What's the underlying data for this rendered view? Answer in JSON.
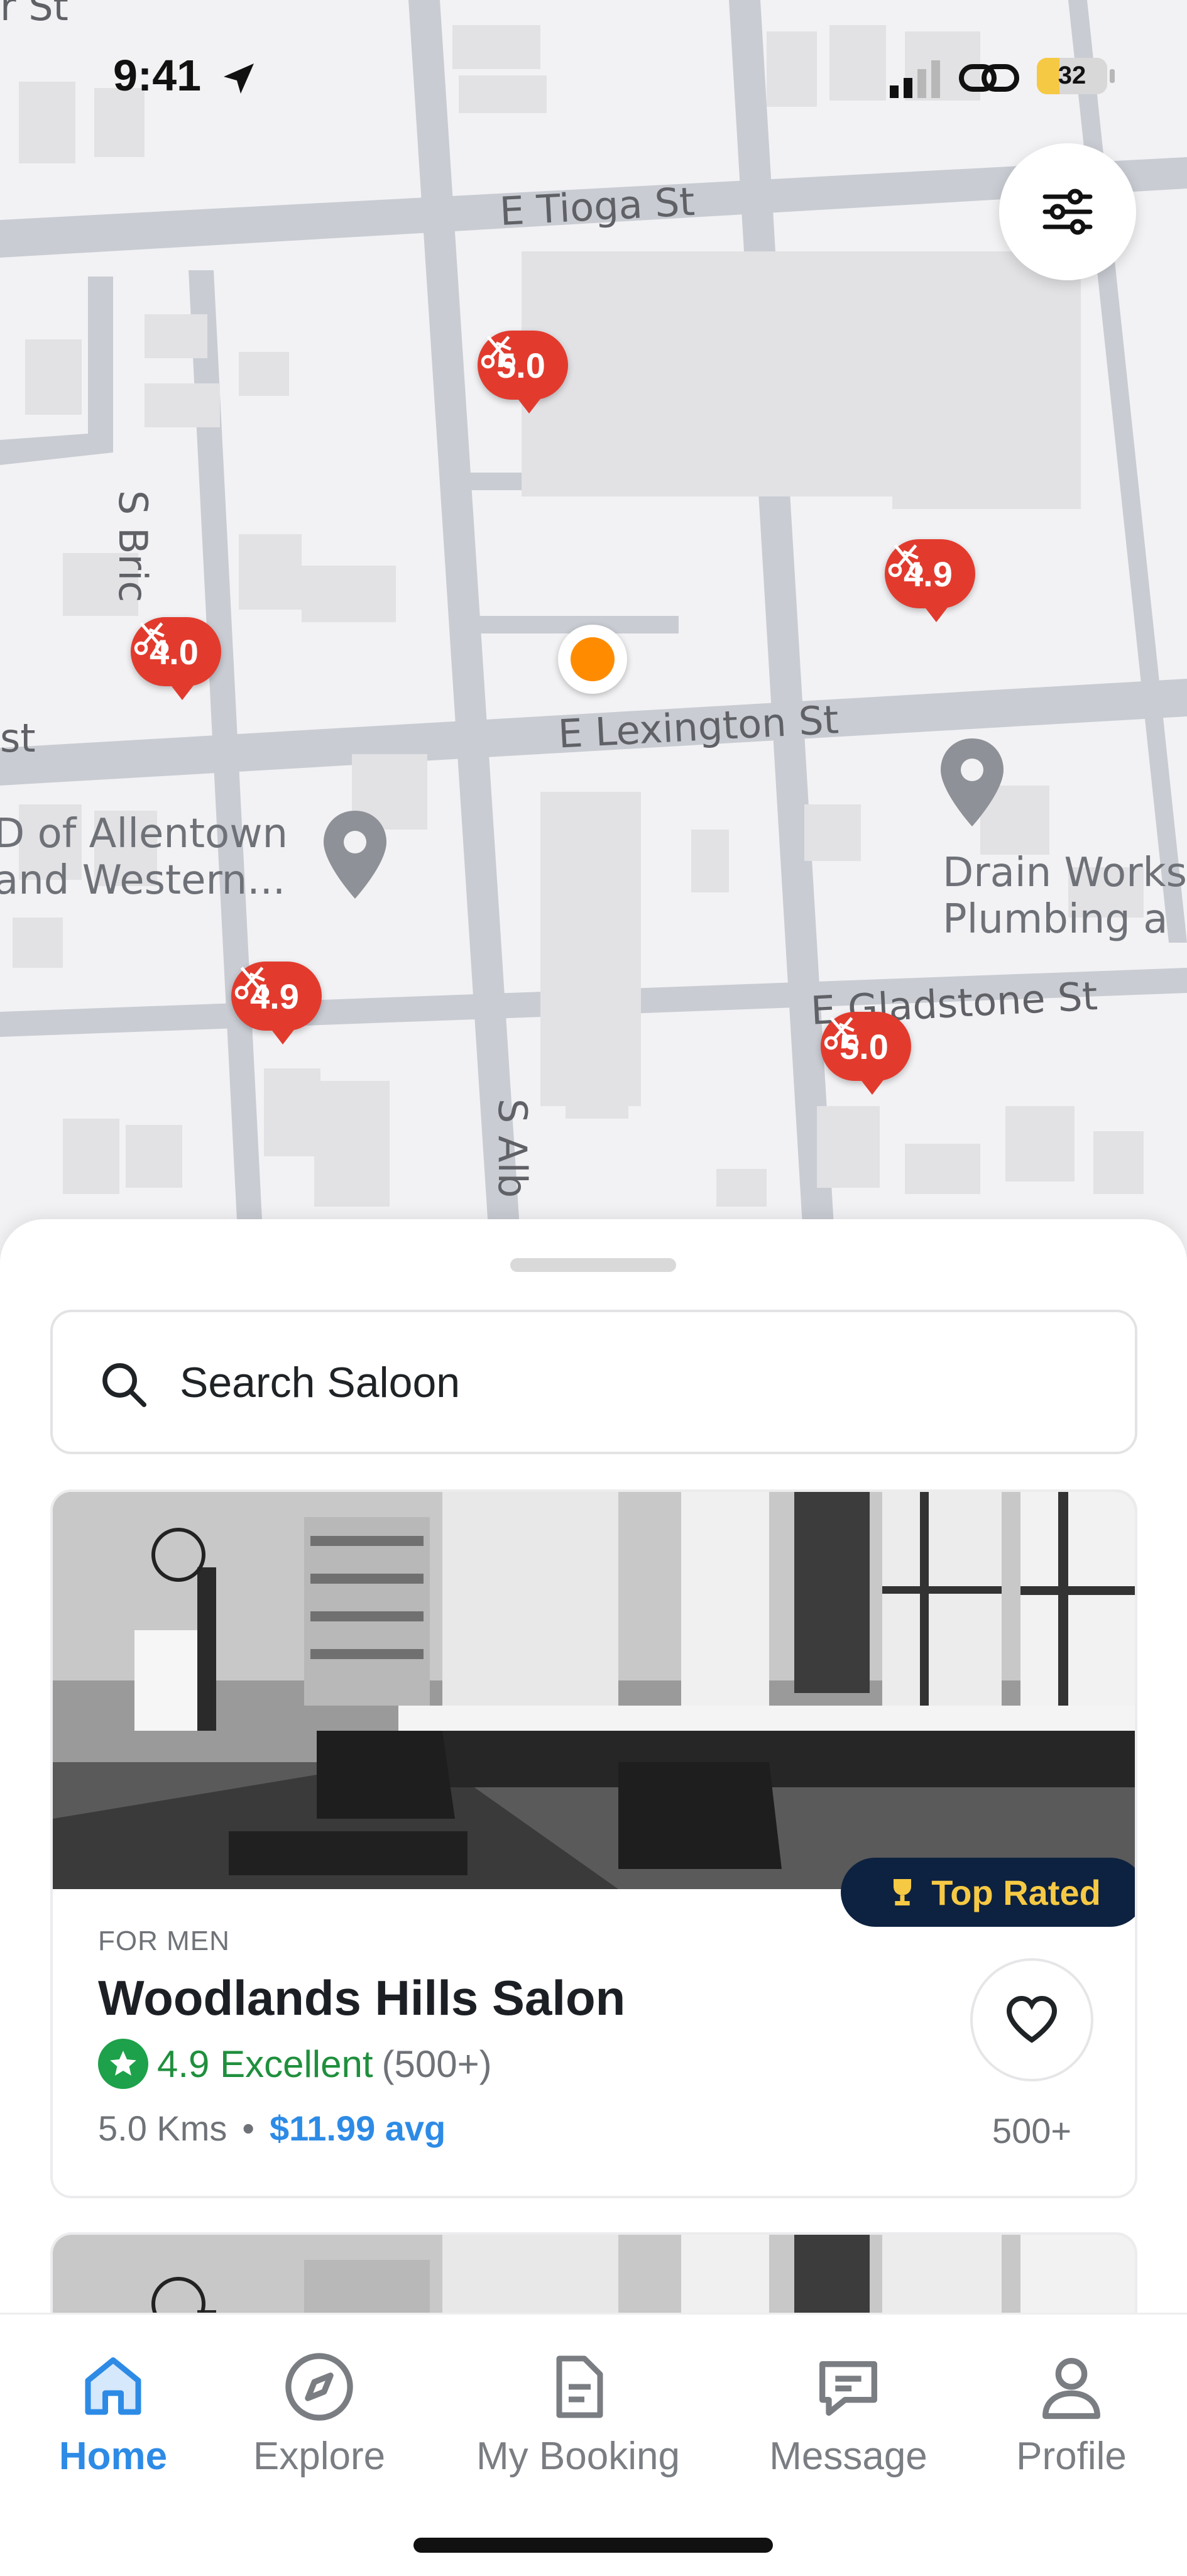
{
  "status_bar": {
    "time": "9:41",
    "battery_level": "32",
    "battery_fraction": 0.32
  },
  "map": {
    "streets": [
      "E Tioga St",
      "S Bric",
      "E Lexington St",
      "S Alb",
      "st",
      "r St",
      "E Gladstone St"
    ],
    "places": [
      {
        "name": "D of Allentown and Western...",
        "lines": [
          "D of Allentown",
          "and Western..."
        ]
      },
      {
        "name": "Drain Works Plumbing a",
        "lines": [
          "Drain Works",
          "Plumbing a"
        ]
      }
    ],
    "salon_pins": [
      "5.0",
      "4.9",
      "4.0",
      "4.9",
      "5.0"
    ],
    "filter_icon": "sliders-icon",
    "accent": "#e23b2e"
  },
  "search": {
    "placeholder": "Search Saloon",
    "value": ""
  },
  "listing": {
    "badge": "Top Rated",
    "category": "FOR MEN",
    "name": "Woodlands Hills Salon",
    "rating": "4.9 Excellent",
    "rating_count": "(500+)",
    "distance": "5.0 Kms",
    "separator": "•",
    "price": "$11.99 avg",
    "favorites": "500+"
  },
  "tabs": [
    {
      "label": "Home",
      "icon": "home-icon",
      "active": true
    },
    {
      "label": "Explore",
      "icon": "compass-icon",
      "active": false
    },
    {
      "label": "My Booking",
      "icon": "document-icon",
      "active": false
    },
    {
      "label": "Message",
      "icon": "chat-icon",
      "active": false
    },
    {
      "label": "Profile",
      "icon": "user-icon",
      "active": false
    }
  ],
  "colors": {
    "primary": "#2d8be6",
    "rating_green": "#1da14a",
    "badge_bg": "#0d2240",
    "badge_text": "#f6c945",
    "user_location": "#ff8c00"
  }
}
